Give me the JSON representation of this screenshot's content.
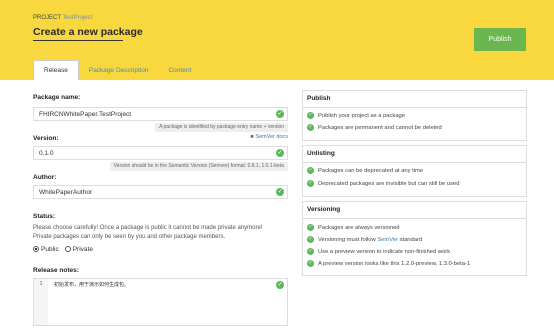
{
  "header": {
    "project_prefix": "PROJECT",
    "project_name": "TestProject",
    "title": "Create a new package",
    "publish_label": "Publish"
  },
  "tabs": [
    {
      "label": "Release"
    },
    {
      "label": "Package Description"
    },
    {
      "label": "Content"
    }
  ],
  "form": {
    "package_name_label": "Package name:",
    "package_name_value": "FHIRCNWhitePaper.TestProject",
    "package_name_hint": "A package is identified by package entry name + version",
    "semver_docs": "SemVer docs",
    "version_label": "Version:",
    "version_value": "0.1.0",
    "version_hint": "Version should be in the Semantic Version (Semver) format: 0.8.1, 1.0.1-beta",
    "author_label": "Author:",
    "author_value": "WhitePaperAuthor",
    "status_label": "Status:",
    "status_text_1": "Please choose carefully! Once a package is public it cannot be made private anymore!",
    "status_text_2": "Private packages can only be seen by you and other package members.",
    "public_label": "Public",
    "private_label": "Private",
    "release_notes_label": "Release notes:",
    "release_notes_line_no": "1",
    "release_notes_text": "初始发布，用于演示如何生成包。"
  },
  "publish_box": {
    "title": "Publish",
    "items": [
      "Publish your project as a package",
      "Packages are permanent and cannot be deleted"
    ]
  },
  "unlisting_box": {
    "title": "Unlisting",
    "items": [
      "Packages can be deprecated at any time",
      "Deprecated packages are invisible but can still be used"
    ]
  },
  "versioning_box": {
    "title": "Versioning",
    "item_1": "Packages are always versioned",
    "item_2_prefix": "Versioning must follow",
    "item_2_link": "SemVer",
    "item_2_suffix": "standard",
    "item_3": "Use a preview version to indicate non-finished work",
    "item_4": "A preview version looks like this 1.2.0-preview, 1.3.0-beta-1"
  },
  "colors": {
    "header_bg": "#f9d73e",
    "publish_btn": "#6ab74f",
    "check_green": "#5cb85c",
    "link_blue": "#2f7ab5"
  },
  "icons": {
    "check": "check-circle-icon",
    "docs": "book-icon"
  }
}
